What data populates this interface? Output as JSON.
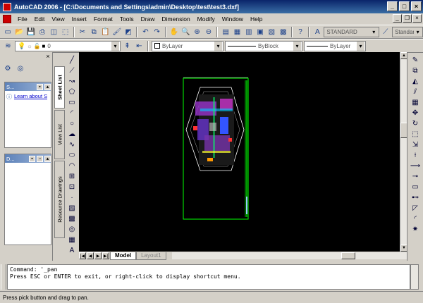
{
  "window": {
    "title": "AutoCAD 2006 - [C:\\Documents and Settings\\admin\\Desktop\\test\\test3.dxf]"
  },
  "menu": [
    "File",
    "Edit",
    "View",
    "Insert",
    "Format",
    "Tools",
    "Draw",
    "Dimension",
    "Modify",
    "Window",
    "Help"
  ],
  "styles": {
    "text_style": "STANDARD",
    "dim_style": "Standard"
  },
  "properties": {
    "layer": "0",
    "color": "ByLayer",
    "linetype": "ByBlock",
    "lineweight": "ByLayer"
  },
  "sheet_set": {
    "section1_title": "S...",
    "link": "Learn about S",
    "section2_title": "D..."
  },
  "side_tabs": [
    "Sheet List",
    "View List",
    "Resource Drawings"
  ],
  "layout_tabs": [
    "Model",
    "Layout1"
  ],
  "command": {
    "line1": "Command: '_pan",
    "line2": "Press ESC or ENTER to exit, or right-click to display shortcut menu."
  },
  "status": "Press pick button and drag to pan."
}
